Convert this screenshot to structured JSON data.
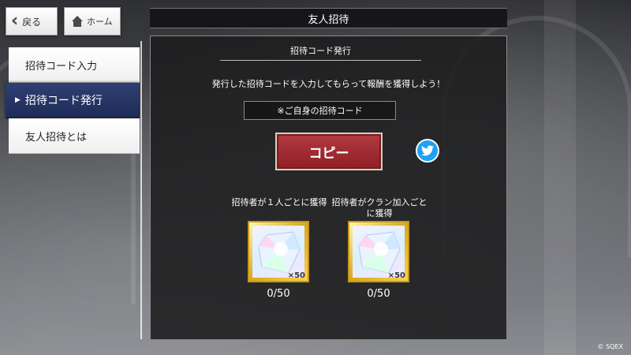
{
  "nav": {
    "back_label": "戻る",
    "home_label": "ホーム"
  },
  "title": "友人招待",
  "side_menu": {
    "items": [
      {
        "label": "招待コード入力"
      },
      {
        "label": "招待コード発行"
      },
      {
        "label": "友人招待とは"
      }
    ],
    "active_index": 1
  },
  "panel": {
    "subtitle": "招待コード発行",
    "description": "発行した招待コードを入力してもらって報酬を獲得しよう！",
    "code_label": "※ご自身の招待コード",
    "copy_label": "コピー",
    "share_icon": "twitter-icon",
    "rewards": [
      {
        "label": "招待者が１人ごとに獲得",
        "icon": "crystal-icon",
        "quantity": "×50",
        "progress": "0/50"
      },
      {
        "label": "招待者がクラン加入ごとに獲得",
        "icon": "crystal-icon",
        "quantity": "×50",
        "progress": "0/50"
      }
    ]
  },
  "copyright": "© SQEX",
  "colors": {
    "active_tab": "#26356a",
    "copy_button": "#a3303a",
    "twitter": "#1da1f2",
    "reward_frame": "#d8a820"
  }
}
